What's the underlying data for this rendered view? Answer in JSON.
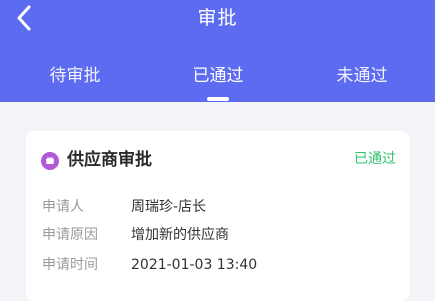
{
  "header": {
    "title": "审批",
    "tabs": [
      {
        "label": "待审批"
      },
      {
        "label": "已通过"
      },
      {
        "label": "未通过"
      }
    ],
    "active_tab": "已通过",
    "brand_color": "#5c6bf0"
  },
  "card": {
    "icon": "shop-icon",
    "title": "供应商审批",
    "status": "已通过",
    "status_color": "#2fc26b",
    "rows": [
      {
        "label": "申请人",
        "value": "周瑞珍-店长"
      },
      {
        "label": "申请原因",
        "value": "增加新的供应商"
      },
      {
        "label": "申请时间",
        "value": "2021-01-03 13:40"
      }
    ]
  }
}
